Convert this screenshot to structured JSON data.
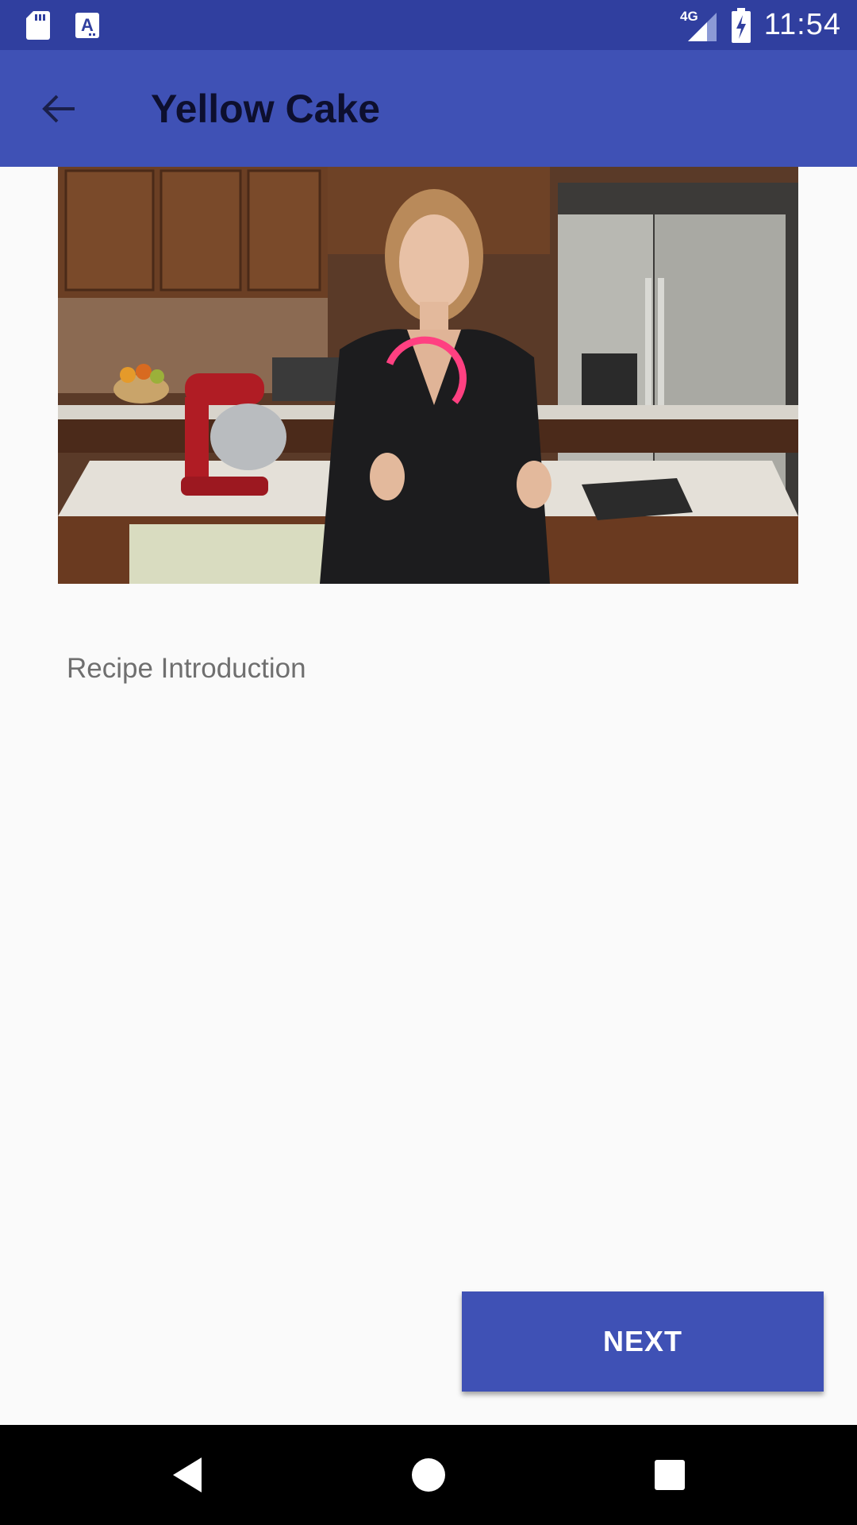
{
  "status_bar": {
    "time": "11:54",
    "network_label": "4G",
    "icons": [
      "sd-card-icon",
      "text-a-icon",
      "signal-4g-icon",
      "battery-charging-icon"
    ]
  },
  "app_bar": {
    "title": "Yellow Cake",
    "back_icon": "arrow-back-icon"
  },
  "video": {
    "description": "kitchen-presenter-video",
    "loading_indicator_color": "#ff4081"
  },
  "step": {
    "short_description": "Recipe Introduction"
  },
  "actions": {
    "next_label": "NEXT"
  },
  "nav_bar": {
    "icons": [
      "back-triangle-icon",
      "home-circle-icon",
      "recents-square-icon"
    ]
  },
  "colors": {
    "primary": "#3f51b5",
    "primary_dark": "#303f9f",
    "accent": "#ff4081",
    "background": "#fafafa"
  }
}
